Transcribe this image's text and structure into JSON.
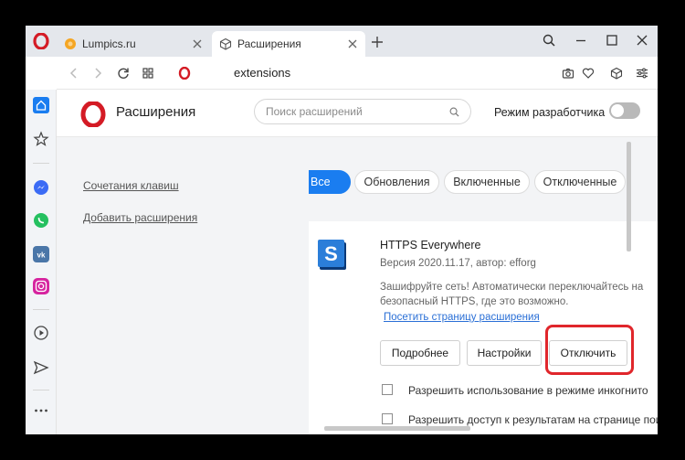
{
  "tabs": [
    {
      "label": "Lumpics.ru",
      "icon": "orange-favicon-icon"
    },
    {
      "label": "Расширения",
      "icon": "cube-icon",
      "active": true
    }
  ],
  "address_bar": {
    "url": "extensions"
  },
  "page": {
    "title": "Расширения",
    "search_placeholder": "Поиск расширений",
    "dev_mode_label": "Режим разработчика",
    "dev_mode_enabled": false
  },
  "nav": {
    "shortcuts": "Сочетания клавиш",
    "add_extensions": "Добавить расширения"
  },
  "filters": {
    "all": "Все",
    "updates": "Обновления",
    "enabled": "Включенные",
    "disabled": "Отключенные"
  },
  "extension": {
    "name": "HTTPS Everywhere",
    "meta": "Версия 2020.11.17, автор: efforg",
    "description": "Зашифруйте сеть! Автоматически переключайтесь на безопасный HTTPS, где это возможно.",
    "link": "Посетить страницу расширения",
    "details_button": "Подробнее",
    "settings_button": "Настройки",
    "disable_button": "Отключить",
    "incognito_label": "Разрешить использование в режиме инкогнито",
    "search_results_label": "Разрешить доступ к результатам на странице поиска"
  },
  "colors": {
    "accent": "#1a7df0",
    "highlight": "#e0262b",
    "opera_red": "#d41b25"
  }
}
